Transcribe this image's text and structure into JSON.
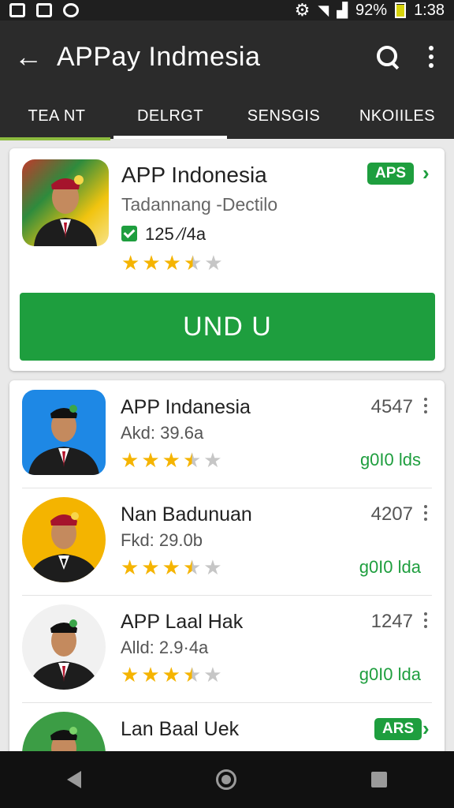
{
  "status_bar": {
    "battery": "92%",
    "time": "1:38",
    "battery_level": 0.92
  },
  "app_bar": {
    "title": "APPay Indmesia"
  },
  "tabs": [
    {
      "label": "TEA NT"
    },
    {
      "label": "DELRGT"
    },
    {
      "label": "SENSGIS"
    },
    {
      "label": "NKOIILES"
    }
  ],
  "featured": {
    "title": "APP Indonesia",
    "subtitle": "Tadannang -Dectilo",
    "count": "125 ⁄/4a",
    "badge": "APS",
    "rating": 3.5,
    "install_label": "UND U"
  },
  "apps": [
    {
      "title": "APP Indanesia",
      "sub": "Akd: 39.6a",
      "num": "4547",
      "dl": "g0I0 lds",
      "rating": 3.5
    },
    {
      "title": "Nan Badunuan",
      "sub": "Fkd: 29.0b",
      "num": "4207",
      "dl": "g0I0 lda",
      "rating": 3.5
    },
    {
      "title": "APP Laal Hak",
      "sub": "Alld: 2.9·4a",
      "num": "1247",
      "dl": "g0I0 lda",
      "rating": 3.5
    },
    {
      "title": "Lan Baal Uek",
      "sub": "",
      "badge": "ARS"
    }
  ],
  "colors": {
    "accent_green": "#1e9e3e",
    "star": "#f5b400",
    "bar": "#2b2b2b"
  },
  "icons": [
    "back-arrow-icon",
    "search-icon",
    "more-vert-icon",
    "check-icon",
    "chevron-right-icon",
    "nav-back-icon",
    "nav-home-icon",
    "nav-recent-icon"
  ]
}
